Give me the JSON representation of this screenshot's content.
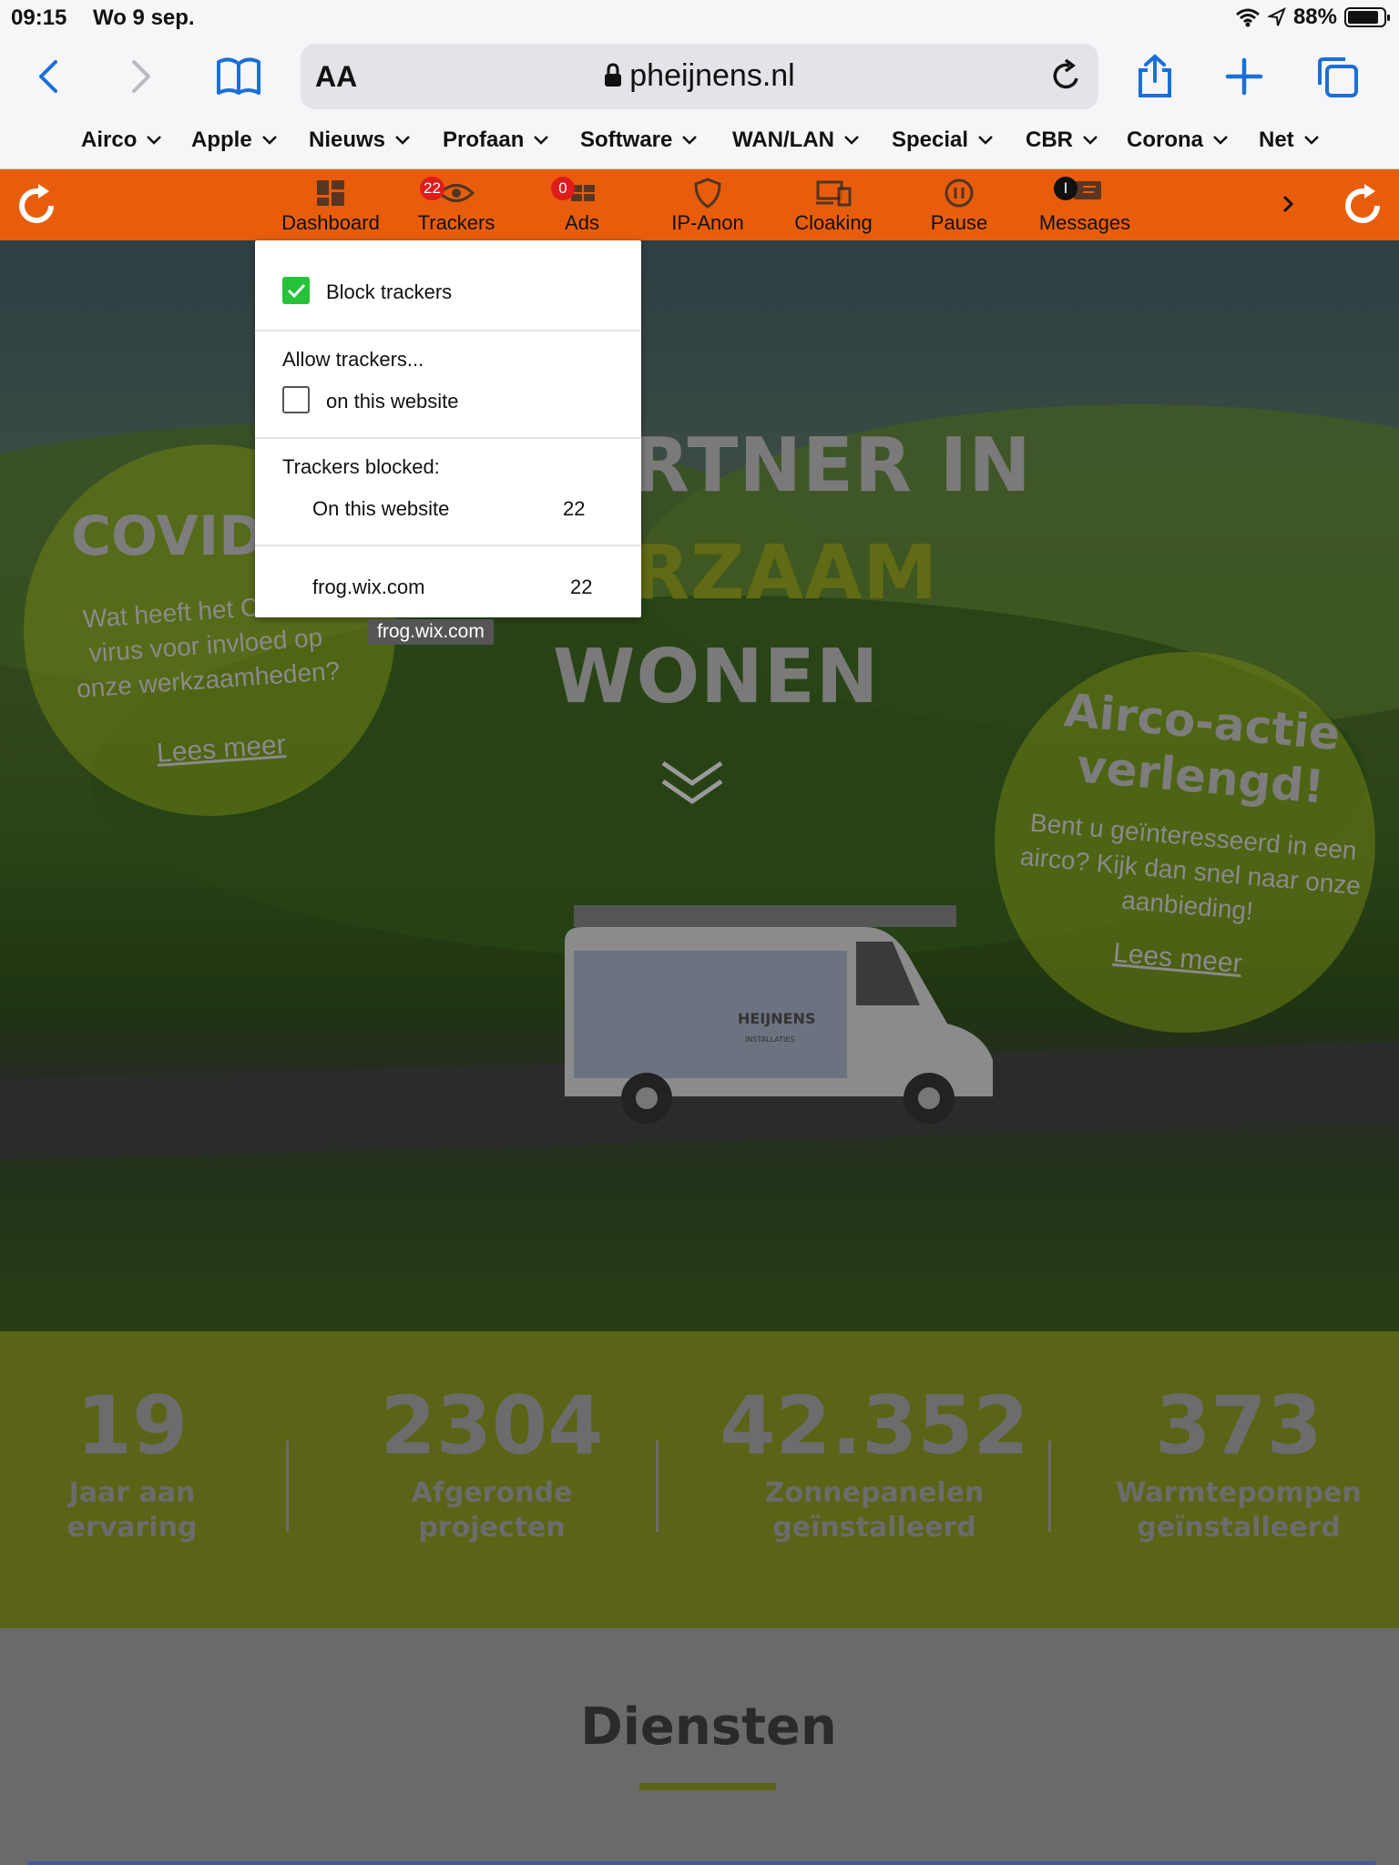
{
  "status": {
    "time": "09:15",
    "date": "Wo 9 sep.",
    "battery": "88%"
  },
  "browser": {
    "text_size_label": "AA",
    "url": "pheijnens.nl",
    "icons": [
      "back-icon",
      "forward-icon",
      "bookmarks-icon",
      "lock-icon",
      "reload-icon",
      "share-icon",
      "add-tab-icon",
      "tabs-icon"
    ]
  },
  "bookmarks": [
    "Airco",
    "Apple",
    "Nieuws",
    "Profaan",
    "Software",
    "WAN/LAN",
    "Special",
    "CBR",
    "Corona",
    "Net"
  ],
  "extension": {
    "accent": "#e85d0c",
    "items": [
      {
        "label": "Dashboard",
        "icon": "dashboard-icon"
      },
      {
        "label": "Trackers",
        "icon": "eye-icon",
        "badge": "22"
      },
      {
        "label": "Ads",
        "icon": "ads-icon",
        "badge": "0"
      },
      {
        "label": "IP-Anon",
        "icon": "shield-icon"
      },
      {
        "label": "Cloaking",
        "icon": "devices-icon"
      },
      {
        "label": "Pause",
        "icon": "pause-icon"
      },
      {
        "label": "Messages",
        "icon": "messages-icon",
        "badge": "I"
      }
    ]
  },
  "popup": {
    "block_label": "Block trackers",
    "block_checked": true,
    "allow_title": "Allow trackers...",
    "allow_site_label": "on this website",
    "allow_site_checked": false,
    "blocked_title": "Trackers blocked:",
    "blocked_site_label": "On this website",
    "blocked_site_count": "22",
    "domain": "frog.wix.com",
    "domain_count": "22",
    "tooltip": "frog.wix.com"
  },
  "hero": {
    "line1": "RTNER IN",
    "line2": "RZAAM",
    "line3": "WONEN",
    "left_bubble": {
      "title": "COVID-",
      "text": "Wat heeft het Corona virus voor invloed op onze werkzaamheden?",
      "link": "Lees meer"
    },
    "right_bubble": {
      "title1": "Airco-actie",
      "title2": "verlengd!",
      "text": "Bent u geïnteresseerd in een airco? Kijk dan snel naar onze aanbieding!",
      "link": "Lees meer"
    },
    "van_brand": "HEIJNENS",
    "van_sub": "INSTALLATIES"
  },
  "stats": [
    {
      "num": "19",
      "cap1": "Jaar aan",
      "cap2": "ervaring"
    },
    {
      "num": "2304",
      "cap1": "Afgeronde",
      "cap2": "projecten"
    },
    {
      "num": "42.352",
      "cap1": "Zonnepanelen",
      "cap2": "geïnstalleerd"
    },
    {
      "num": "373",
      "cap1": "Warmtepompen",
      "cap2": "geïnstalleerd"
    }
  ],
  "services": {
    "title": "Diensten"
  },
  "colors": {
    "check_green": "#25c23a",
    "badge_red": "#e01b1b",
    "site_green": "#5b6316",
    "ios_blue": "#1a6fd8"
  }
}
